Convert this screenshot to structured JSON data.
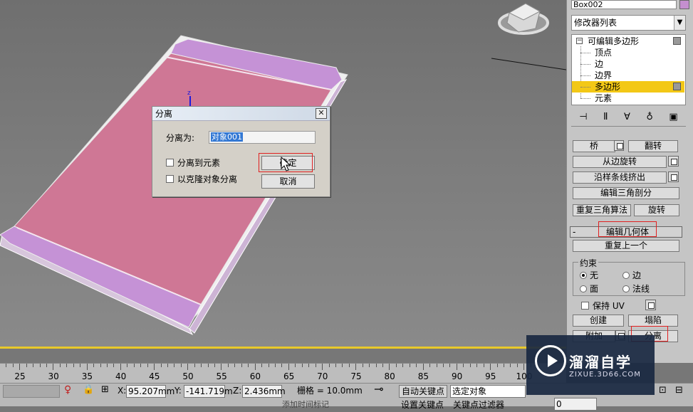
{
  "dialog": {
    "title": "分离",
    "separate_as_label": "分离为:",
    "object_name_value": "对象001",
    "option_to_element": "分离到元素",
    "option_as_clone": "以克隆对象分离",
    "ok_label": "确定",
    "cancel_label": "取消"
  },
  "viewport": {
    "axis_label": "z"
  },
  "panel": {
    "object_name": "Box002",
    "object_color": "#c48fcf",
    "modifier_list": "修改器列表",
    "stack": {
      "root": "可编辑多边形",
      "items": [
        "顶点",
        "边",
        "边界",
        "多边形",
        "元素"
      ],
      "selected": "多边形"
    },
    "buttons": {
      "bridge": "桥",
      "flip": "翻转",
      "hinge_from_edge": "从边旋转",
      "extrude_along_spline": "沿样条线挤出",
      "edit_triangulation": "编辑三角剖分",
      "retriangulate": "重复三角算法",
      "turn": "旋转",
      "repeat_last": "重复上一个",
      "create": "创建",
      "collapse": "塌陷",
      "attach": "附加",
      "detach": "分离"
    },
    "rollout_edit_geometry": "编辑几何体",
    "rollout_collapse_symbol": "-",
    "constraints": {
      "label": "约束",
      "none": "无",
      "edge": "边",
      "face": "面",
      "normal": "法线",
      "selected": "无"
    },
    "preserve_uv": "保持 UV"
  },
  "timeline": {
    "ticks": [
      "25",
      "30",
      "35",
      "40",
      "45",
      "50",
      "55",
      "60",
      "65",
      "70",
      "75",
      "80",
      "85",
      "90",
      "95",
      "100"
    ]
  },
  "status": {
    "x_label": "X:",
    "x_value": "95.207mm",
    "y_label": "Y:",
    "y_value": "-141.719m",
    "z_label": "Z:",
    "z_value": "2.436mm",
    "grid": "栅格 = 10.0mm",
    "auto_key": "自动关键点",
    "selected_object": "选定对象",
    "set_key": "设置关键点",
    "key_filters": "关键点过滤器",
    "frame_value": "0",
    "bottom_hint": "添加时间标记"
  },
  "watermark": {
    "title": "溜溜自学",
    "url": "ZIXUE.3D66.COM"
  }
}
